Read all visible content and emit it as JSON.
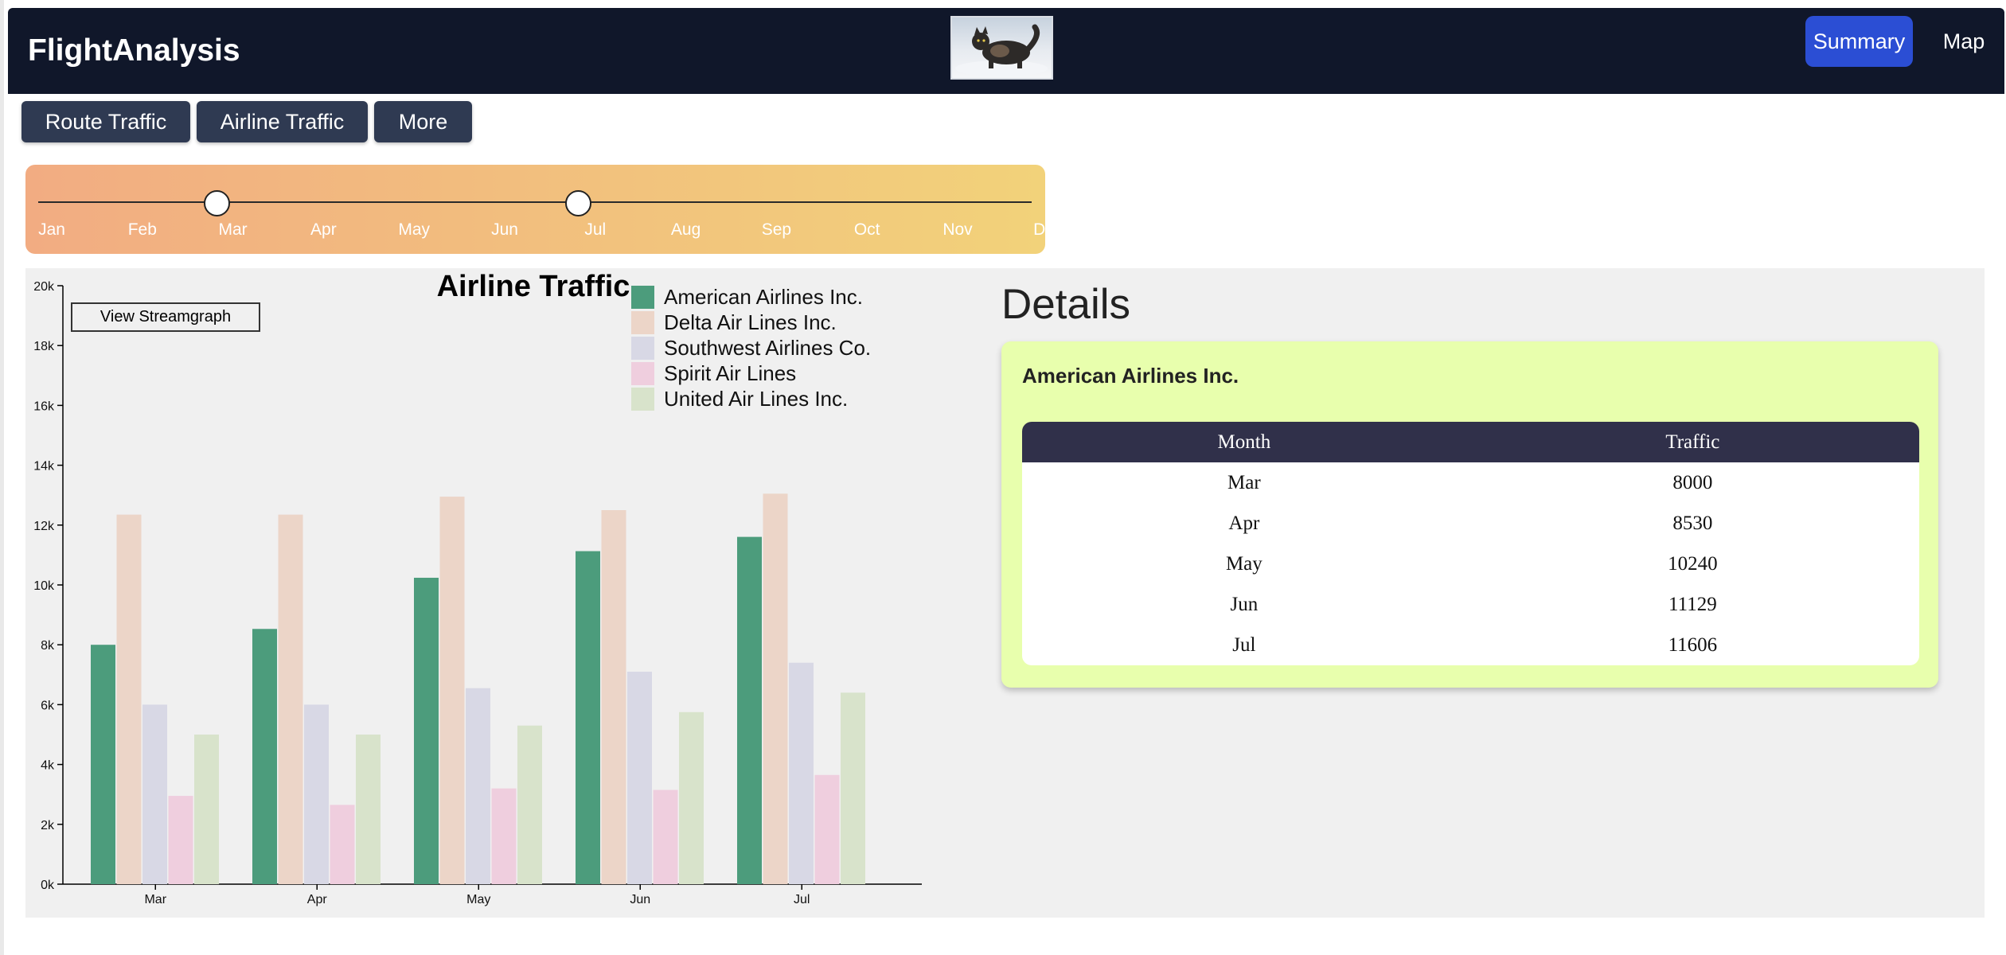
{
  "header": {
    "brand": "FlightAnalysis",
    "nav": {
      "summary": "Summary",
      "map": "Map"
    }
  },
  "tabs": [
    {
      "label": "Route Traffic"
    },
    {
      "label": "Airline Traffic"
    },
    {
      "label": "More"
    }
  ],
  "slider": {
    "months": [
      "Jan",
      "Feb",
      "Mar",
      "Apr",
      "May",
      "Jun",
      "Jul",
      "Aug",
      "Sep",
      "Oct",
      "Nov",
      "Dec"
    ],
    "range_start": "Mar",
    "range_end": "Jul"
  },
  "chart": {
    "stream_button": "View Streamgraph"
  },
  "chart_data": {
    "type": "bar",
    "title": "Airline Traffic",
    "categories": [
      "Mar",
      "Apr",
      "May",
      "Jun",
      "Jul"
    ],
    "y_ticks": [
      "0k",
      "2k",
      "4k",
      "6k",
      "8k",
      "10k",
      "12k",
      "14k",
      "16k",
      "18k",
      "20k"
    ],
    "ylim": [
      0,
      20000
    ],
    "legend_position": "top-right",
    "series": [
      {
        "name": "American Airlines Inc.",
        "color": "#4c9c7c",
        "values": [
          8000,
          8530,
          10240,
          11129,
          11606
        ]
      },
      {
        "name": "Delta Air Lines Inc.",
        "color": "#ecd5c8",
        "values": [
          12350,
          12350,
          12950,
          12500,
          13050
        ]
      },
      {
        "name": "Southwest Airlines Co.",
        "color": "#d8d8e5",
        "values": [
          6000,
          6000,
          6550,
          7100,
          7400
        ]
      },
      {
        "name": "Spirit Air Lines",
        "color": "#efcede",
        "values": [
          2950,
          2650,
          3200,
          3150,
          3650
        ]
      },
      {
        "name": "United Air Lines Inc.",
        "color": "#d8e3cb",
        "values": [
          5000,
          5000,
          5300,
          5750,
          6400
        ]
      }
    ]
  },
  "details": {
    "title": "Details",
    "airline": "American Airlines Inc.",
    "columns": [
      "Month",
      "Traffic"
    ],
    "rows": [
      [
        "Mar",
        "8000"
      ],
      [
        "Apr",
        "8530"
      ],
      [
        "May",
        "10240"
      ],
      [
        "Jun",
        "11129"
      ],
      [
        "Jul",
        "11606"
      ]
    ]
  },
  "colors": {
    "navbar": "#10172a",
    "accent": "#2b4ed4",
    "tab": "#2f3a52",
    "card": "#e8ffad",
    "table_header": "#30304a"
  }
}
